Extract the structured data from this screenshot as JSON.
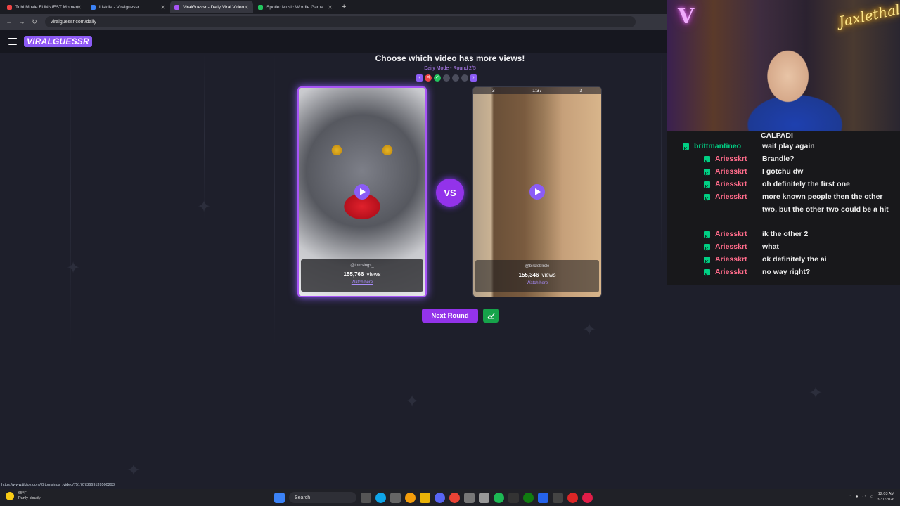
{
  "browser": {
    "tabs": [
      {
        "label": "Tubi Movie FUNNIEST Moment",
        "color": "#ef4444",
        "active": false
      },
      {
        "label": "Listdle - Viralguessr",
        "color": "#3b82f6",
        "active": false
      },
      {
        "label": "ViralGuessr - Daily Viral Video",
        "color": "#a855f7",
        "active": true
      },
      {
        "label": "Spotle: Music Wordle Game",
        "color": "#22c55e",
        "active": false
      }
    ],
    "url": "viralguessr.com/daily"
  },
  "site": {
    "logo": "VIRALGUESSR"
  },
  "game": {
    "prompt": "Choose which video has more views!",
    "mode": "Daily Mode - Round 2/5",
    "rounds": [
      "wrong",
      "right",
      "pending",
      "pending",
      "pending"
    ],
    "left": {
      "handle": "@tomsings_",
      "views": "155,766",
      "views_label": "views",
      "watch": "Watch here"
    },
    "right": {
      "handle": "@bircleblrcle",
      "views": "155,346",
      "views_label": "views",
      "watch": "Watch here",
      "hud": [
        "3",
        "1:37",
        "3"
      ]
    },
    "vs": "VS",
    "next_round": "Next Round"
  },
  "status_url": "https://www.tiktok.com/@tomsings_/video/7517073669139500293",
  "stream": {
    "neon_sign": "Jaxlethal",
    "chat_top": "CALPADI",
    "chat": [
      {
        "user": "brittmantineo",
        "text": "wait play again",
        "green": true
      },
      {
        "user": "Ariesskrt",
        "text": "Brandle?",
        "green": false
      },
      {
        "user": "Ariesskrt",
        "text": "I gotchu dw",
        "green": false
      },
      {
        "user": "Ariesskrt",
        "text": "oh definitely the first one",
        "green": false
      },
      {
        "user": "Ariesskrt",
        "text": "more known people then the other two, but the other two could be a hit",
        "green": false
      },
      {
        "user": "Ariesskrt",
        "text": "ik the other 2",
        "green": false
      },
      {
        "user": "Ariesskrt",
        "text": "what",
        "green": false
      },
      {
        "user": "Ariesskrt",
        "text": "ok definitely the ai",
        "green": false
      },
      {
        "user": "Ariesskrt",
        "text": "no way right?",
        "green": false
      }
    ]
  },
  "taskbar": {
    "temp": "65°F",
    "weather": "Partly cloudy",
    "search": "Search",
    "time": "12:03 AM",
    "date": "3/31/2026"
  }
}
